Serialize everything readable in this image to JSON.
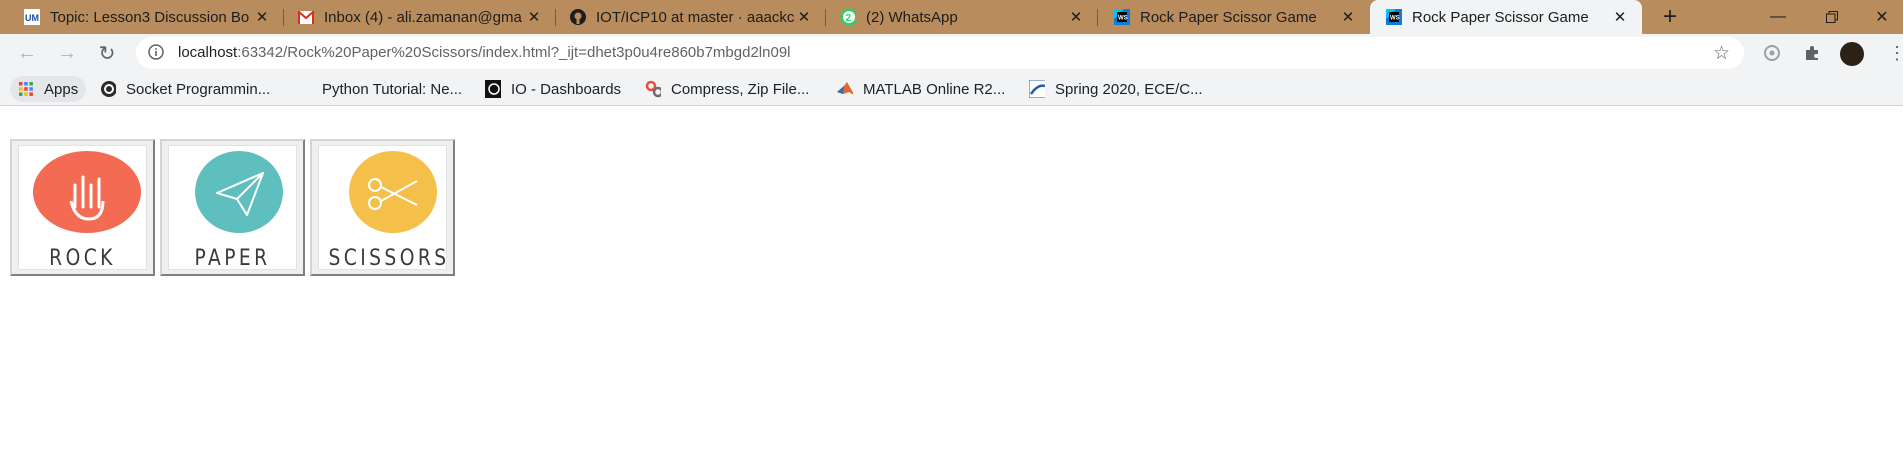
{
  "tabs": [
    {
      "title": "Topic: Lesson3 Discussion Bo",
      "icon": "umkc-icon",
      "active": false
    },
    {
      "title": "Inbox (4) - ali.zamanan@gma",
      "icon": "gmail-icon",
      "active": false
    },
    {
      "title": "IOT/ICP10 at master · aaackc",
      "icon": "github-icon",
      "active": false
    },
    {
      "title": "(2) WhatsApp",
      "icon": "whatsapp-icon",
      "badge": "2",
      "active": false
    },
    {
      "title": "Rock Paper Scissor Game",
      "icon": "webstorm-icon",
      "active": false
    },
    {
      "title": "Rock Paper Scissor Game",
      "icon": "webstorm-icon",
      "active": true
    }
  ],
  "toolbar": {
    "url_host": "localhost",
    "url_rest": ":63342/Rock%20Paper%20Scissors/index.html?_ijt=dhet3p0u4re860b7mbgd2ln09l"
  },
  "bookmarks": [
    {
      "label": "Apps",
      "icon": "apps-grid-icon"
    },
    {
      "label": "Socket Programmin...",
      "icon": "python-icon"
    },
    {
      "label": "Python Tutorial: Ne...",
      "icon": "none"
    },
    {
      "label": "IO - Dashboards",
      "icon": "io-icon"
    },
    {
      "label": "Compress, Zip File...",
      "icon": "gears-icon"
    },
    {
      "label": "MATLAB Online R2...",
      "icon": "matlab-icon"
    },
    {
      "label": "Spring 2020, ECE/C...",
      "icon": "canvas-icon"
    }
  ],
  "game": {
    "choices": [
      {
        "label": "ROCK",
        "color": "#f26b52",
        "icon": "rock-hand-icon"
      },
      {
        "label": "PAPER",
        "color": "#5fbfbf",
        "icon": "paper-plane-icon"
      },
      {
        "label": "SCISSORS",
        "color": "#f5c04a",
        "icon": "scissors-icon"
      }
    ]
  },
  "colors": {
    "tabstrip": "#b98c5d",
    "toolbar": "#f1f3f4"
  }
}
